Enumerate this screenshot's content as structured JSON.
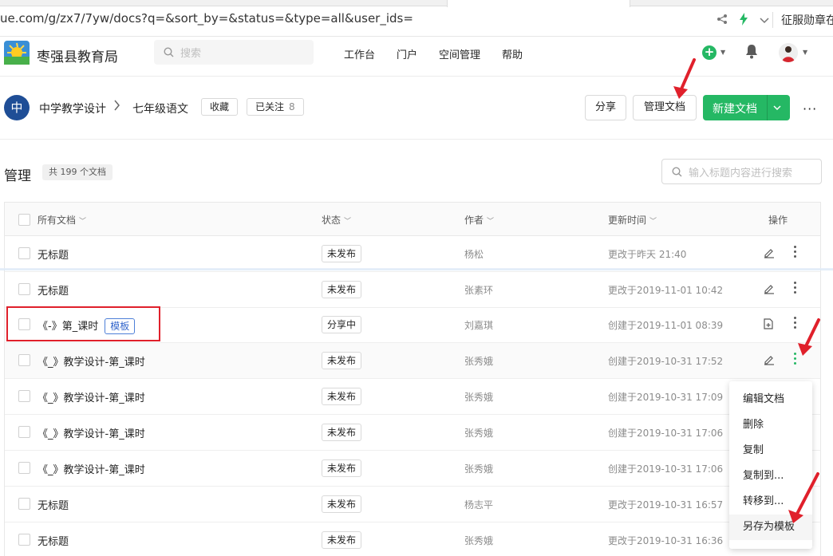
{
  "browser": {
    "url": "ue.com/g/zx7/7yw/docs?q=&sort_by=&status=&type=all&user_ids=",
    "right_text": "征服勋章在"
  },
  "header": {
    "app_name": "枣强县教育局",
    "search_placeholder": "搜索",
    "nav": [
      "工作台",
      "门户",
      "空间管理",
      "帮助"
    ],
    "accent": "#25b864"
  },
  "breadcrumb": {
    "space_avatar": "中",
    "group": "中学教学设计",
    "book": "七年级语文",
    "collect_label": "收藏",
    "follow_label": "已关注",
    "follow_count": "8",
    "share_label": "分享",
    "manage_label": "管理文档",
    "new_doc_label": "新建文档"
  },
  "page": {
    "title": "管理",
    "count_text": "共 199 个文档",
    "search_placeholder": "输入标题内容进行搜索"
  },
  "table": {
    "headers": {
      "all_docs": "所有文档",
      "status": "状态",
      "author": "作者",
      "updated": "更新时间",
      "actions": "操作"
    },
    "rows": [
      {
        "title": "无标题",
        "badge": "",
        "status": "未发布",
        "author": "杨松",
        "time": "更改于昨天 21:40",
        "action": "edit"
      },
      {
        "title": "无标题",
        "badge": "",
        "status": "未发布",
        "author": "张素环",
        "time": "更改于2019-11-01 10:42",
        "action": "edit"
      },
      {
        "title": "《-》第_课时",
        "badge": "模板",
        "status": "分享中",
        "author": "刘嘉琪",
        "time": "创建于2019-11-01 08:39",
        "action": "template"
      },
      {
        "title": "《_》教学设计-第_课时",
        "badge": "",
        "status": "未发布",
        "author": "张秀娥",
        "time": "创建于2019-10-31 17:52",
        "action": "edit"
      },
      {
        "title": "《_》教学设计-第_课时",
        "badge": "",
        "status": "未发布",
        "author": "张秀娥",
        "time": "创建于2019-10-31 17:09",
        "action": "none"
      },
      {
        "title": "《_》教学设计-第_课时",
        "badge": "",
        "status": "未发布",
        "author": "张秀娥",
        "time": "创建于2019-10-31 17:06",
        "action": "none"
      },
      {
        "title": "《_》教学设计-第_课时",
        "badge": "",
        "status": "未发布",
        "author": "张秀娥",
        "time": "创建于2019-10-31 17:06",
        "action": "none"
      },
      {
        "title": "无标题",
        "badge": "",
        "status": "未发布",
        "author": "杨志平",
        "time": "更改于2019-10-31 16:57",
        "action": "none"
      },
      {
        "title": "无标题",
        "badge": "",
        "status": "未发布",
        "author": "张秀娥",
        "time": "更改于2019-10-31 16:36",
        "action": "none"
      }
    ]
  },
  "context_menu": {
    "items": [
      "编辑文档",
      "删除",
      "复制",
      "复制到...",
      "转移到...",
      "另存为模板"
    ],
    "active_index": 5
  }
}
